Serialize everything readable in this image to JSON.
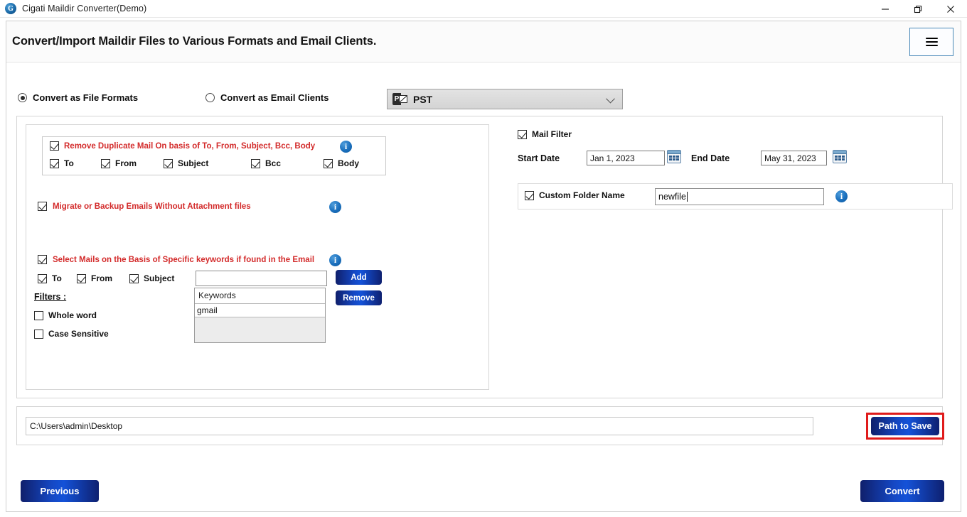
{
  "window": {
    "title": "Cigati Maildir Converter(Demo)",
    "app_icon": "app-logo-icon",
    "minimize": "minimize-icon",
    "restore": "restore-icon",
    "close": "close-icon"
  },
  "header": {
    "title": "Convert/Import Maildir Files to Various Formats and Email Clients.",
    "menu_icon": "hamburger-menu-icon",
    "menu_border_color": "#4a89b8"
  },
  "mode": {
    "file_formats_label": "Convert as File Formats",
    "email_clients_label": "Convert as Email Clients",
    "file_formats_selected": true,
    "email_clients_selected": false,
    "format_select": {
      "value": "PST",
      "icon": "outlook-pst-icon",
      "caret": "chevron-down-icon"
    }
  },
  "left_pane": {
    "duplicate": {
      "title": "Remove Duplicate Mail On basis of To, From, Subject, Bcc, Body",
      "checked": true,
      "info_icon": "info-icon",
      "fields": [
        {
          "label": "To",
          "checked": true
        },
        {
          "label": "From",
          "checked": true
        },
        {
          "label": "Subject",
          "checked": true
        },
        {
          "label": "Bcc",
          "checked": true
        },
        {
          "label": "Body",
          "checked": true
        }
      ]
    },
    "attachment": {
      "title": "Migrate or Backup Emails Without Attachment files",
      "checked": true,
      "info_icon": "info-icon"
    },
    "keywords": {
      "title": "Select Mails on the Basis of Specific keywords if found in the Email",
      "checked": true,
      "info_icon": "info-icon",
      "fields": [
        {
          "label": "To",
          "checked": true
        },
        {
          "label": "From",
          "checked": true
        },
        {
          "label": "Subject",
          "checked": true
        }
      ],
      "input_value": "",
      "add_label": "Add",
      "remove_label": "Remove",
      "list_header": "Keywords",
      "list_items": [
        "gmail"
      ]
    },
    "filters": {
      "title": "Filters :",
      "whole_word_label": "Whole word",
      "whole_word_checked": false,
      "case_sensitive_label": "Case Sensitive",
      "case_sensitive_checked": false
    }
  },
  "right_pane": {
    "mail_filter_label": "Mail Filter",
    "mail_filter_checked": true,
    "start_date_label": "Start Date",
    "start_date_value": "Jan 1, 2023",
    "end_date_label": "End Date",
    "end_date_value": "May 31, 2023",
    "calendar_icon": "calendar-icon",
    "custom_folder_label": "Custom Folder Name",
    "custom_folder_checked": true,
    "custom_folder_value": "newfile",
    "info_icon": "info-icon"
  },
  "path_bar": {
    "path_value": "C:\\Users\\admin\\Desktop",
    "path_to_save_label": "Path to Save",
    "highlight_color": "#e01b1b"
  },
  "footer": {
    "previous_label": "Previous",
    "convert_label": "Convert"
  }
}
